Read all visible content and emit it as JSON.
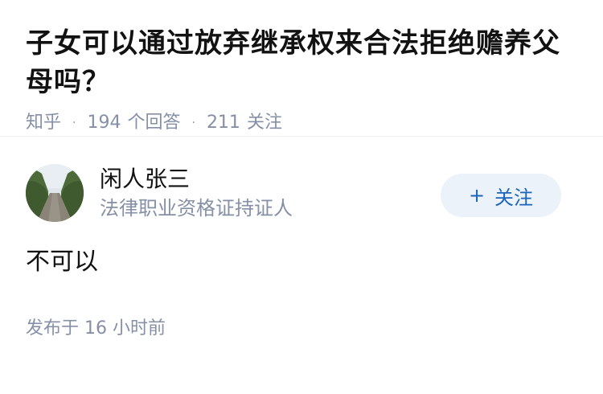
{
  "question": {
    "title": "子女可以通过放弃继承权来合法拒绝赡养父母吗？",
    "source": "知乎",
    "answer_count": "194",
    "answer_label": "个回答",
    "follower_count": "211",
    "follower_label": "关注",
    "separator": "·"
  },
  "answer": {
    "author_name": "闲人张三",
    "author_badge": "法律职业资格证持证人",
    "follow_label": "关注",
    "follow_icon": "plus-icon",
    "content": "不可以",
    "published_prefix": "发布于",
    "published_time": "16 小时前"
  },
  "colors": {
    "meta_gray": "#8590a6",
    "follow_bg": "#ebf2fa",
    "follow_text": "#1a65b8"
  }
}
